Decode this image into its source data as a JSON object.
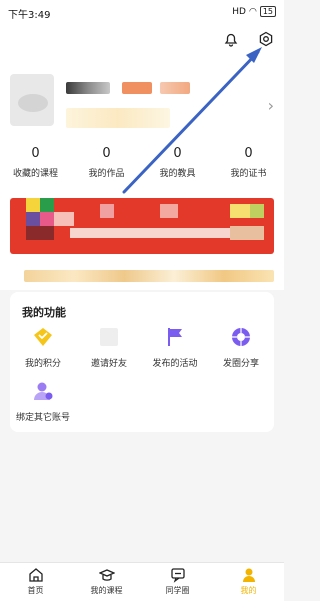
{
  "status_bar": {
    "time": "下午3:49",
    "signal": "HD",
    "battery": "15"
  },
  "header": {
    "settings_icon": "gear-icon",
    "notification_icon": "bell-icon"
  },
  "stats": [
    {
      "value": "0",
      "label": "收藏的课程"
    },
    {
      "value": "0",
      "label": "我的作品"
    },
    {
      "value": "0",
      "label": "我的教具"
    },
    {
      "value": "0",
      "label": "我的证书"
    }
  ],
  "features": {
    "title": "我的功能",
    "items": [
      {
        "label": "我的积分",
        "icon": "points-icon",
        "color": "#f5c518"
      },
      {
        "label": "邀请好友",
        "icon": "invite-icon",
        "color": "#eeeeee"
      },
      {
        "label": "发布的活动",
        "icon": "flag-icon",
        "color": "#7a5cf0"
      },
      {
        "label": "发圈分享",
        "icon": "aperture-icon",
        "color": "#7a5cf0"
      },
      {
        "label": "绑定其它账号",
        "icon": "bind-account-icon",
        "color": "#9b7cf3"
      }
    ]
  },
  "tabbar": {
    "items": [
      {
        "label": "首页",
        "icon": "home-icon"
      },
      {
        "label": "我的课程",
        "icon": "graduation-cap-icon"
      },
      {
        "label": "同学圈",
        "icon": "chat-icon"
      },
      {
        "label": "我的",
        "icon": "person-icon",
        "active": true
      }
    ],
    "active_color": "#f2b400"
  },
  "colors": {
    "annotation_arrow": "#3a63c4",
    "banner": "#e3392a"
  }
}
